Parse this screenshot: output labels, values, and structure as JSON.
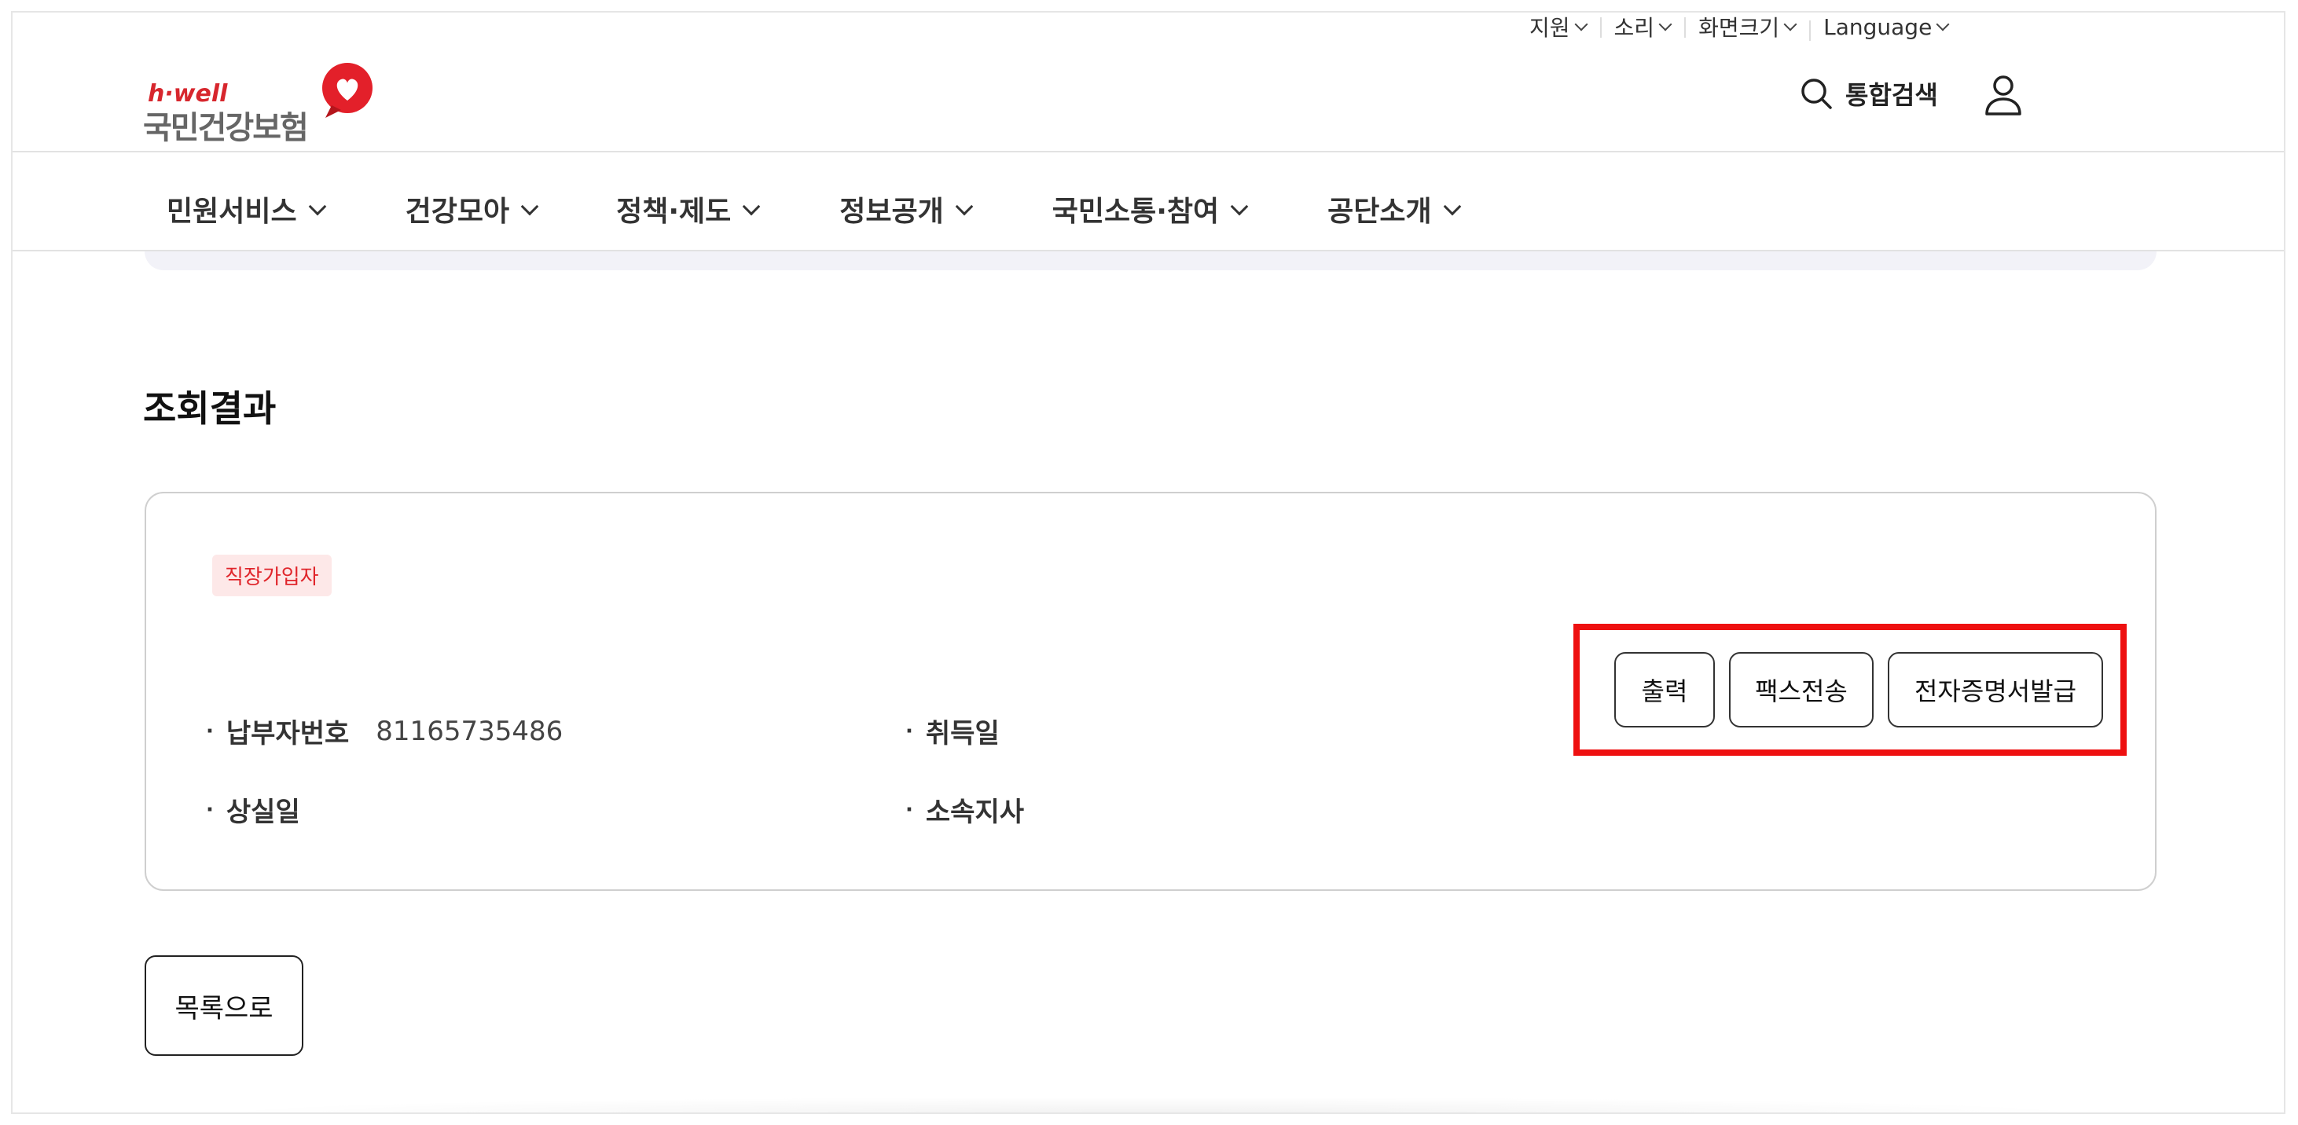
{
  "utility": {
    "items": [
      {
        "label": "지원"
      },
      {
        "label": "소리"
      },
      {
        "label": "화면크기"
      },
      {
        "label": "Language"
      }
    ]
  },
  "header": {
    "logo_small": "h·well",
    "logo_main": "국민건강보험",
    "search_label": "통합검색"
  },
  "gnb": {
    "items": [
      {
        "label": "민원서비스"
      },
      {
        "label": "건강모아"
      },
      {
        "label": "정책·제도"
      },
      {
        "label": "정보공개"
      },
      {
        "label": "국민소통·참여"
      },
      {
        "label": "공단소개"
      }
    ]
  },
  "main": {
    "title": "조회결과",
    "badge": "직장가입자",
    "fields": {
      "payer_no_label": "납부자번호",
      "payer_no_value": "81165735486",
      "acquire_label": "취득일",
      "loss_label": "상실일",
      "branch_label": "소속지사"
    },
    "buttons": {
      "print": "출력",
      "fax": "팩스전송",
      "e_cert": "전자증명서발급"
    },
    "list_button": "목록으로"
  },
  "colors": {
    "brand_red": "#d7262d",
    "highlight_border": "#ee1010",
    "badge_bg": "#fde8e8"
  }
}
